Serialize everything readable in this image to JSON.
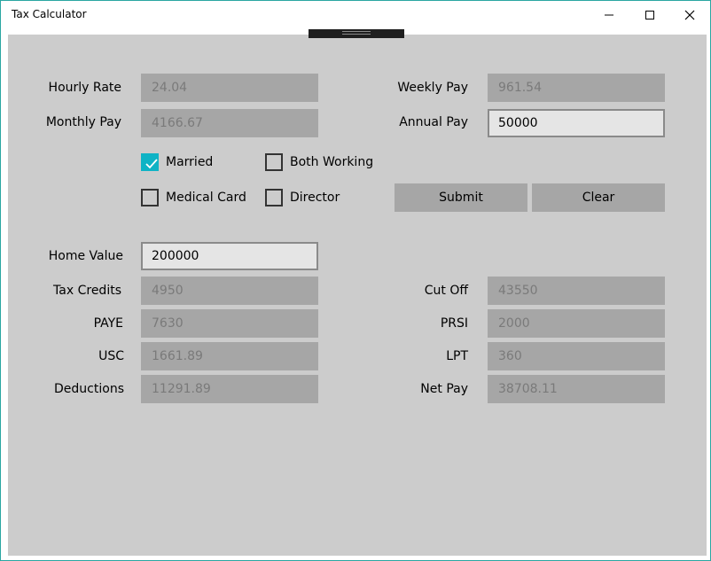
{
  "window": {
    "title": "Tax Calculator"
  },
  "form": {
    "hourly_rate": {
      "label": "Hourly Rate",
      "value": "24.04"
    },
    "monthly_pay": {
      "label": "Monthly Pay",
      "value": "4166.67"
    },
    "weekly_pay": {
      "label": "Weekly Pay",
      "value": "961.54"
    },
    "annual_pay": {
      "label": "Annual Pay",
      "value": "50000"
    },
    "married": {
      "label": "Married",
      "checked": true
    },
    "both_working": {
      "label": "Both Working",
      "checked": false
    },
    "medical_card": {
      "label": "Medical Card",
      "checked": false
    },
    "director": {
      "label": "Director",
      "checked": false
    },
    "submit_label": "Submit",
    "clear_label": "Clear",
    "home_value": {
      "label": "Home Value",
      "value": "200000"
    }
  },
  "results": {
    "tax_credits": {
      "label": "Tax Credits",
      "value": "4950"
    },
    "cut_off": {
      "label": "Cut Off",
      "value": "43550"
    },
    "paye": {
      "label": "PAYE",
      "value": "7630"
    },
    "prsi": {
      "label": "PRSI",
      "value": "2000"
    },
    "usc": {
      "label": "USC",
      "value": "1661.89"
    },
    "lpt": {
      "label": "LPT",
      "value": "360"
    },
    "deductions": {
      "label": "Deductions",
      "value": "11291.89"
    },
    "net_pay": {
      "label": "Net Pay",
      "value": "38708.11"
    }
  },
  "colors": {
    "accent": "#0fb3c5",
    "background": "#cccccc",
    "readonly_field": "#a6a6a6"
  }
}
